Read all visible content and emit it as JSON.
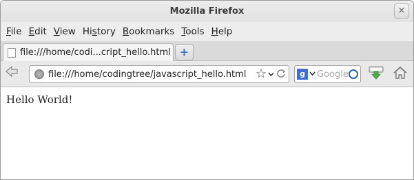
{
  "window": {
    "title": "Mozilla Firefox",
    "close_label": "×"
  },
  "menubar": {
    "items": [
      {
        "first": "F",
        "rest": "ile"
      },
      {
        "first": "E",
        "rest": "dit"
      },
      {
        "first": "V",
        "rest": "iew"
      },
      {
        "first": "",
        "pre": "Hi",
        "u": "s",
        "rest": "tory"
      },
      {
        "first": "B",
        "rest": "ookmarks"
      },
      {
        "first": "T",
        "rest": "ools"
      },
      {
        "first": "H",
        "rest": "elp"
      }
    ]
  },
  "tabs": [
    {
      "label": "file:///home/codi...cript_hello.html",
      "active": true
    }
  ],
  "newtab_label": "+",
  "navbar": {
    "url": "file:///home/codingtree/javascript_hello.html",
    "search_placeholder": "Google",
    "search_engine_letter": "g"
  },
  "content": {
    "text": "Hello World!"
  },
  "icons": {
    "back": "back-arrow-icon",
    "globe": "site-identity-icon",
    "bookmark": "star-icon",
    "history": "dropdown-icon",
    "reload": "reload-icon",
    "engine": "google-icon",
    "search": "magnifier-icon",
    "download": "download-icon",
    "home": "home-icon"
  }
}
